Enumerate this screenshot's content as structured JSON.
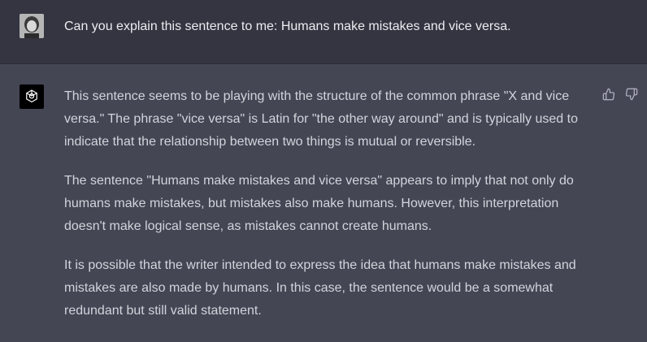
{
  "conversation": {
    "user_message": "Can you explain this sentence to me: Humans make mistakes and vice versa.",
    "assistant_paragraphs": [
      "This sentence seems to be playing with the structure of the common phrase \"X and vice versa.\" The phrase \"vice versa\" is Latin for \"the other way around\" and is typically used to indicate that the relationship between two things is mutual or reversible.",
      "The sentence \"Humans make mistakes and vice versa\" appears to imply that not only do humans make mistakes, but mistakes also make humans. However, this interpretation doesn't make logical sense, as mistakes cannot create humans.",
      "It is possible that the writer intended to express the idea that humans make mistakes and mistakes are also made by humans. In this case, the sentence would be a somewhat redundant but still valid statement."
    ]
  },
  "icons": {
    "user_avatar": "user-avatar",
    "assistant_avatar": "openai-logo-icon",
    "thumbs_up": "thumbs-up-icon",
    "thumbs_down": "thumbs-down-icon"
  },
  "colors": {
    "user_bg": "#343541",
    "assistant_bg": "#444654",
    "text": "#d1d5db"
  }
}
